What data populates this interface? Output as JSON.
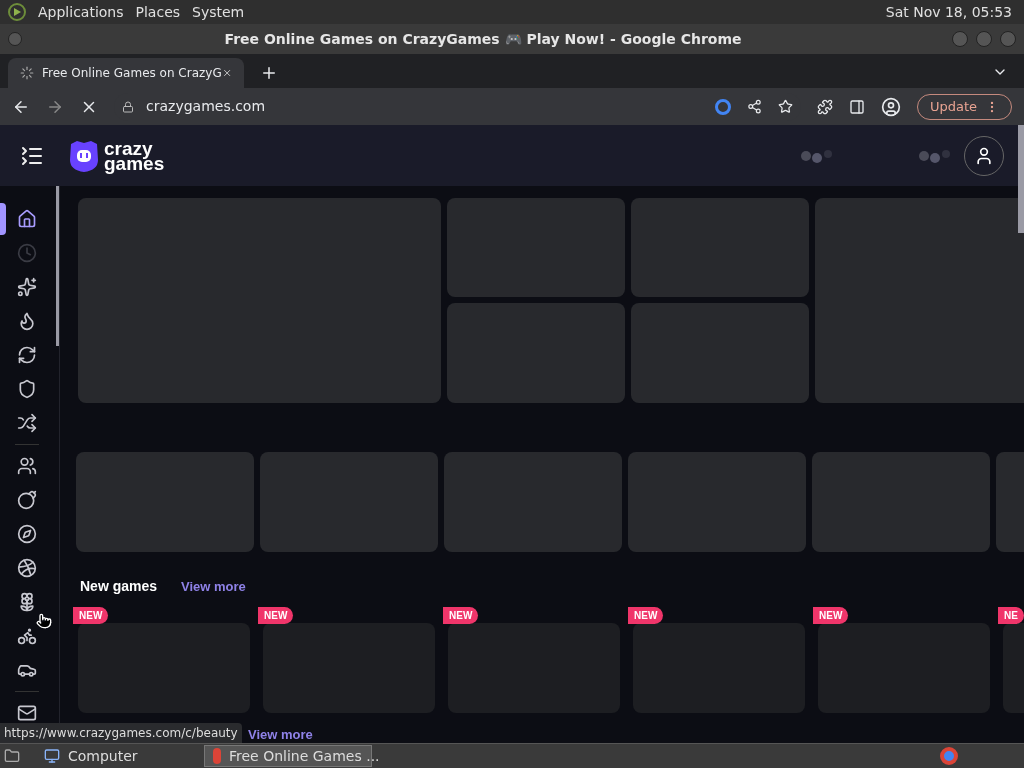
{
  "top_panel": {
    "menus": [
      "Applications",
      "Places",
      "System"
    ],
    "clock": "Sat Nov 18, 05:53"
  },
  "window": {
    "title": "Free Online Games on CrazyGames 🎮 Play Now! - Google Chrome"
  },
  "tabs": [
    {
      "label": "Free Online Games on CrazyG",
      "selected": true,
      "loading": true
    }
  ],
  "address_bar": {
    "url": "crazygames.com",
    "update_label": "Update"
  },
  "site_header": {
    "logo_top": "crazy",
    "logo_bottom": "games"
  },
  "sidebar": {
    "items": [
      {
        "selected": true,
        "disabled": false
      },
      {
        "selected": false,
        "disabled": true
      },
      {
        "selected": false,
        "disabled": false
      },
      {
        "selected": false,
        "disabled": false
      },
      {
        "selected": false,
        "disabled": false
      },
      {
        "selected": false,
        "disabled": false
      },
      {
        "selected": false,
        "disabled": false
      },
      {
        "selected": false,
        "disabled": false
      },
      {
        "selected": false,
        "disabled": false
      },
      {
        "selected": false,
        "disabled": false
      },
      {
        "selected": false,
        "disabled": false
      },
      {
        "selected": false,
        "disabled": false
      },
      {
        "selected": false,
        "disabled": false
      },
      {
        "selected": false,
        "disabled": false
      },
      {
        "selected": false,
        "disabled": false
      }
    ]
  },
  "new_games": {
    "title": "New games",
    "link": "View more",
    "badges": [
      "NEW",
      "NEW",
      "NEW",
      "NEW",
      "NEW",
      "NE"
    ]
  },
  "next_section": {
    "link": "View more"
  },
  "status_url": "https://www.crazygames.com/c/beauty",
  "taskbar": {
    "items": [
      {
        "label": "Computer",
        "selected": false
      },
      {
        "label": "Free Online Games ...",
        "selected": true
      }
    ]
  }
}
